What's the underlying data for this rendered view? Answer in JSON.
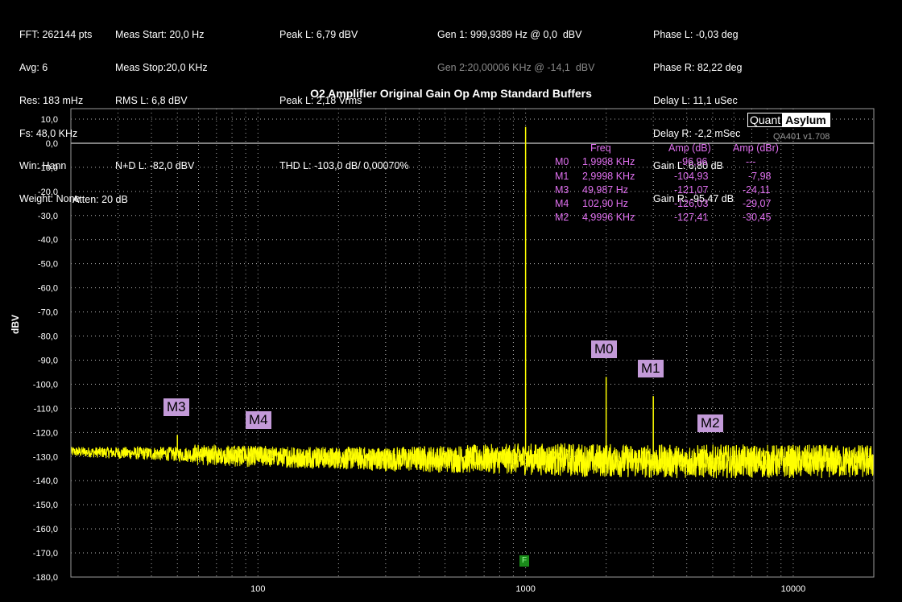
{
  "header": {
    "col1": [
      "FFT: 262144 pts",
      "Avg: 6",
      "Res: 183 mHz",
      "Fs: 48,0 KHz",
      "Win: Hann",
      "Weight: None"
    ],
    "col2": [
      "Meas Start: 20,0 Hz",
      "Meas Stop:20,0 KHz",
      "RMS L: 6,8 dBV",
      "",
      "N+D L: -82,0 dBV"
    ],
    "col3": [
      "Peak L: 6,79 dBV",
      "",
      "Peak L: 2,18 Vrms",
      "",
      "THD L: -103,0 dB/ 0,00070%"
    ],
    "gen1": "Gen 1: 999,9389 Hz @ 0,0  dBV",
    "gen2": "Gen 2:20,00006 KHz @ -14,1  dBV",
    "col5": [
      "Phase L: -0,03 deg",
      "Phase R: 82,22 deg",
      "Delay L: 11,1 uSec",
      "Delay R: -2,2 mSec",
      "Gain L: 6,80 dB",
      "Gain R: -95,47 dB"
    ]
  },
  "logo": {
    "quant": "Quant",
    "asylum": "Asylum"
  },
  "version": "QA401 v1.708",
  "atten": "Atten: 20 dB",
  "f_marker": "F",
  "marker_table": {
    "headers": [
      "Freq",
      "Amp (dB)",
      "Amp (dBr)"
    ],
    "rows": [
      {
        "id": "M0",
        "freq": "1,9998 KHz",
        "amp": "-96,96",
        "ampr": "---"
      },
      {
        "id": "M1",
        "freq": "2,9998 KHz",
        "amp": "-104,93",
        "ampr": "-7,98"
      },
      {
        "id": "M3",
        "freq": "49,987 Hz",
        "amp": "-121,07",
        "ampr": "-24,11"
      },
      {
        "id": "M4",
        "freq": "102,90 Hz",
        "amp": "-126,03",
        "ampr": "-29,07"
      },
      {
        "id": "M2",
        "freq": "4,9996 KHz",
        "amp": "-127,41",
        "ampr": "-30,45"
      }
    ]
  },
  "colors": {
    "trace": "#ffff00",
    "marker_text": "#e070f0",
    "marker_label_bg": "#c39ad8",
    "grid": "#ffffff"
  },
  "chart_data": {
    "type": "line",
    "title": "O2 Amplifier Original Gain Op Amp Standard Buffers",
    "xlabel": "",
    "ylabel": "dBV",
    "xscale": "log",
    "xlim": [
      20,
      20000
    ],
    "ylim": [
      -180,
      10
    ],
    "x_ticks": [
      100,
      1000,
      10000
    ],
    "x_tick_labels": [
      "100",
      "1000",
      "10000"
    ],
    "y_ticks": [
      10,
      0,
      -10,
      -20,
      -30,
      -40,
      -50,
      -60,
      -70,
      -80,
      -90,
      -100,
      -110,
      -120,
      -130,
      -140,
      -150,
      -160,
      -170,
      -180
    ],
    "y_tick_labels": [
      "10,0",
      "0,0",
      "-10,0",
      "-20,0",
      "-30,0",
      "-40,0",
      "-50,0",
      "-60,0",
      "-70,0",
      "-80,0",
      "-90,0",
      "-100,0",
      "-110,0",
      "-120,0",
      "-130,0",
      "-140,0",
      "-150,0",
      "-160,0",
      "-170,0",
      "-180,0"
    ],
    "grid": true,
    "reference_line_y": 0,
    "noise_floor": [
      [
        20,
        -128
      ],
      [
        50,
        -129
      ],
      [
        100,
        -130
      ],
      [
        300,
        -131
      ],
      [
        1000,
        -131
      ],
      [
        3000,
        -132
      ],
      [
        10000,
        -132
      ],
      [
        20000,
        -132
      ]
    ],
    "peaks": [
      {
        "x": 999.94,
        "y": 6.8,
        "label": ""
      },
      {
        "x": 49.987,
        "y": -121.07,
        "label": "M3"
      },
      {
        "x": 102.9,
        "y": -126.03,
        "label": "M4"
      },
      {
        "x": 1999.8,
        "y": -96.96,
        "label": "M0"
      },
      {
        "x": 2999.8,
        "y": -104.93,
        "label": "M1"
      },
      {
        "x": 4999.6,
        "y": -127.41,
        "label": "M2"
      }
    ]
  }
}
